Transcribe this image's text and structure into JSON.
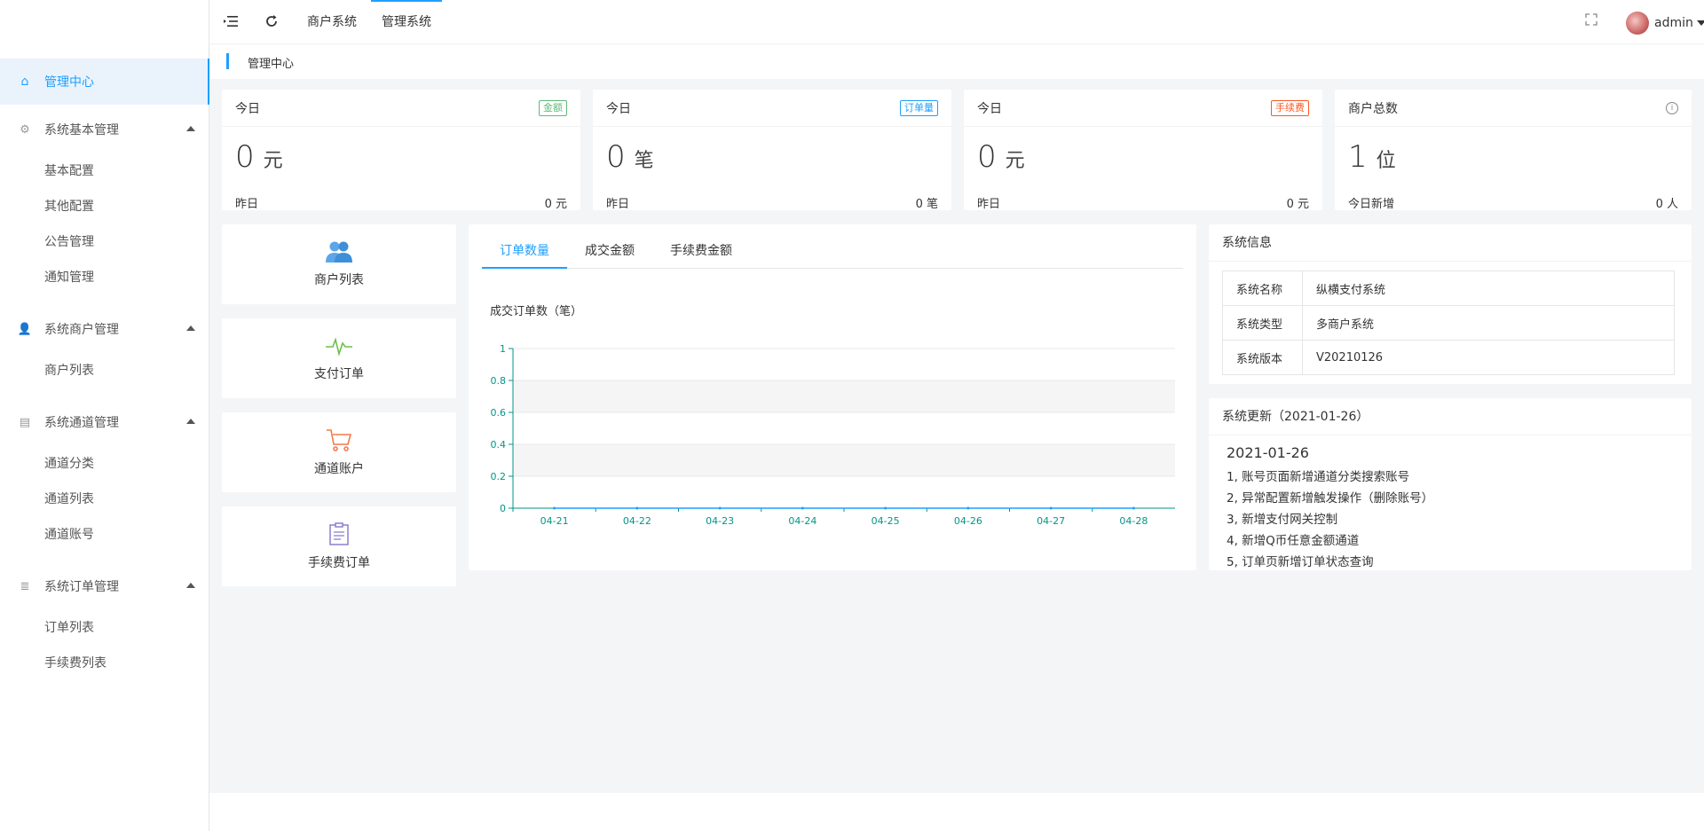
{
  "header": {
    "nav_links": [
      "商户系统",
      "管理系统"
    ],
    "user_name": "admin"
  },
  "sidebar": {
    "home": "管理中心",
    "groups": [
      {
        "label": "系统基本管理",
        "items": [
          "基本配置",
          "其他配置",
          "公告管理",
          "通知管理"
        ]
      },
      {
        "label": "系统商户管理",
        "items": [
          "商户列表"
        ]
      },
      {
        "label": "系统通道管理",
        "items": [
          "通道分类",
          "通道列表",
          "通道账号"
        ]
      },
      {
        "label": "系统订单管理",
        "items": [
          "订单列表",
          "手续费列表"
        ]
      }
    ]
  },
  "breadcrumb": "管理中心",
  "stats": [
    {
      "title": "今日",
      "badge": "金额",
      "badge_color": "#5fb878",
      "value": "0",
      "unit": "元",
      "foot_label": "昨日",
      "foot_value": "0 元"
    },
    {
      "title": "今日",
      "badge": "订单量",
      "badge_color": "#1e9fff",
      "value": "0",
      "unit": "笔",
      "foot_label": "昨日",
      "foot_value": "0 笔"
    },
    {
      "title": "今日",
      "badge": "手续费",
      "badge_color": "#ff5722",
      "value": "0",
      "unit": "元",
      "foot_label": "昨日",
      "foot_value": "0 元"
    },
    {
      "title": "商户总数",
      "badge": "",
      "value": "1",
      "unit": "位",
      "foot_label": "今日新增",
      "foot_value": "0 人"
    }
  ],
  "quick_links": [
    "商户列表",
    "支付订单",
    "通道账户",
    "手续费订单"
  ],
  "chart_tabs": [
    "订单数量",
    "成交金额",
    "手续费金额"
  ],
  "chart_data": {
    "type": "line",
    "title": "成交订单数（笔）",
    "categories": [
      "04-21",
      "04-22",
      "04-23",
      "04-24",
      "04-25",
      "04-26",
      "04-27",
      "04-28"
    ],
    "values": [
      0,
      0,
      0,
      0,
      0,
      0,
      0,
      0
    ],
    "ylim": [
      0,
      1
    ],
    "yticks": [
      "1",
      "0.8",
      "0.6",
      "0.4",
      "0.2",
      "0"
    ],
    "axis_color": "#009688"
  },
  "system_info": {
    "title": "系统信息",
    "rows": [
      {
        "key": "系统名称",
        "value": "纵横支付系统"
      },
      {
        "key": "系统类型",
        "value": "多商户系统"
      },
      {
        "key": "系统版本",
        "value": "V20210126"
      }
    ]
  },
  "system_update": {
    "title": "系统更新（2021-01-26）",
    "date": "2021-01-26",
    "lines": [
      "1, 账号页面新增通道分类搜索账号",
      "2, 异常配置新增触发操作（删除账号）",
      "3, 新增支付网关控制",
      "4, 新增Q币任意金额通道",
      "5, 订单页新增订单状态查询"
    ]
  }
}
